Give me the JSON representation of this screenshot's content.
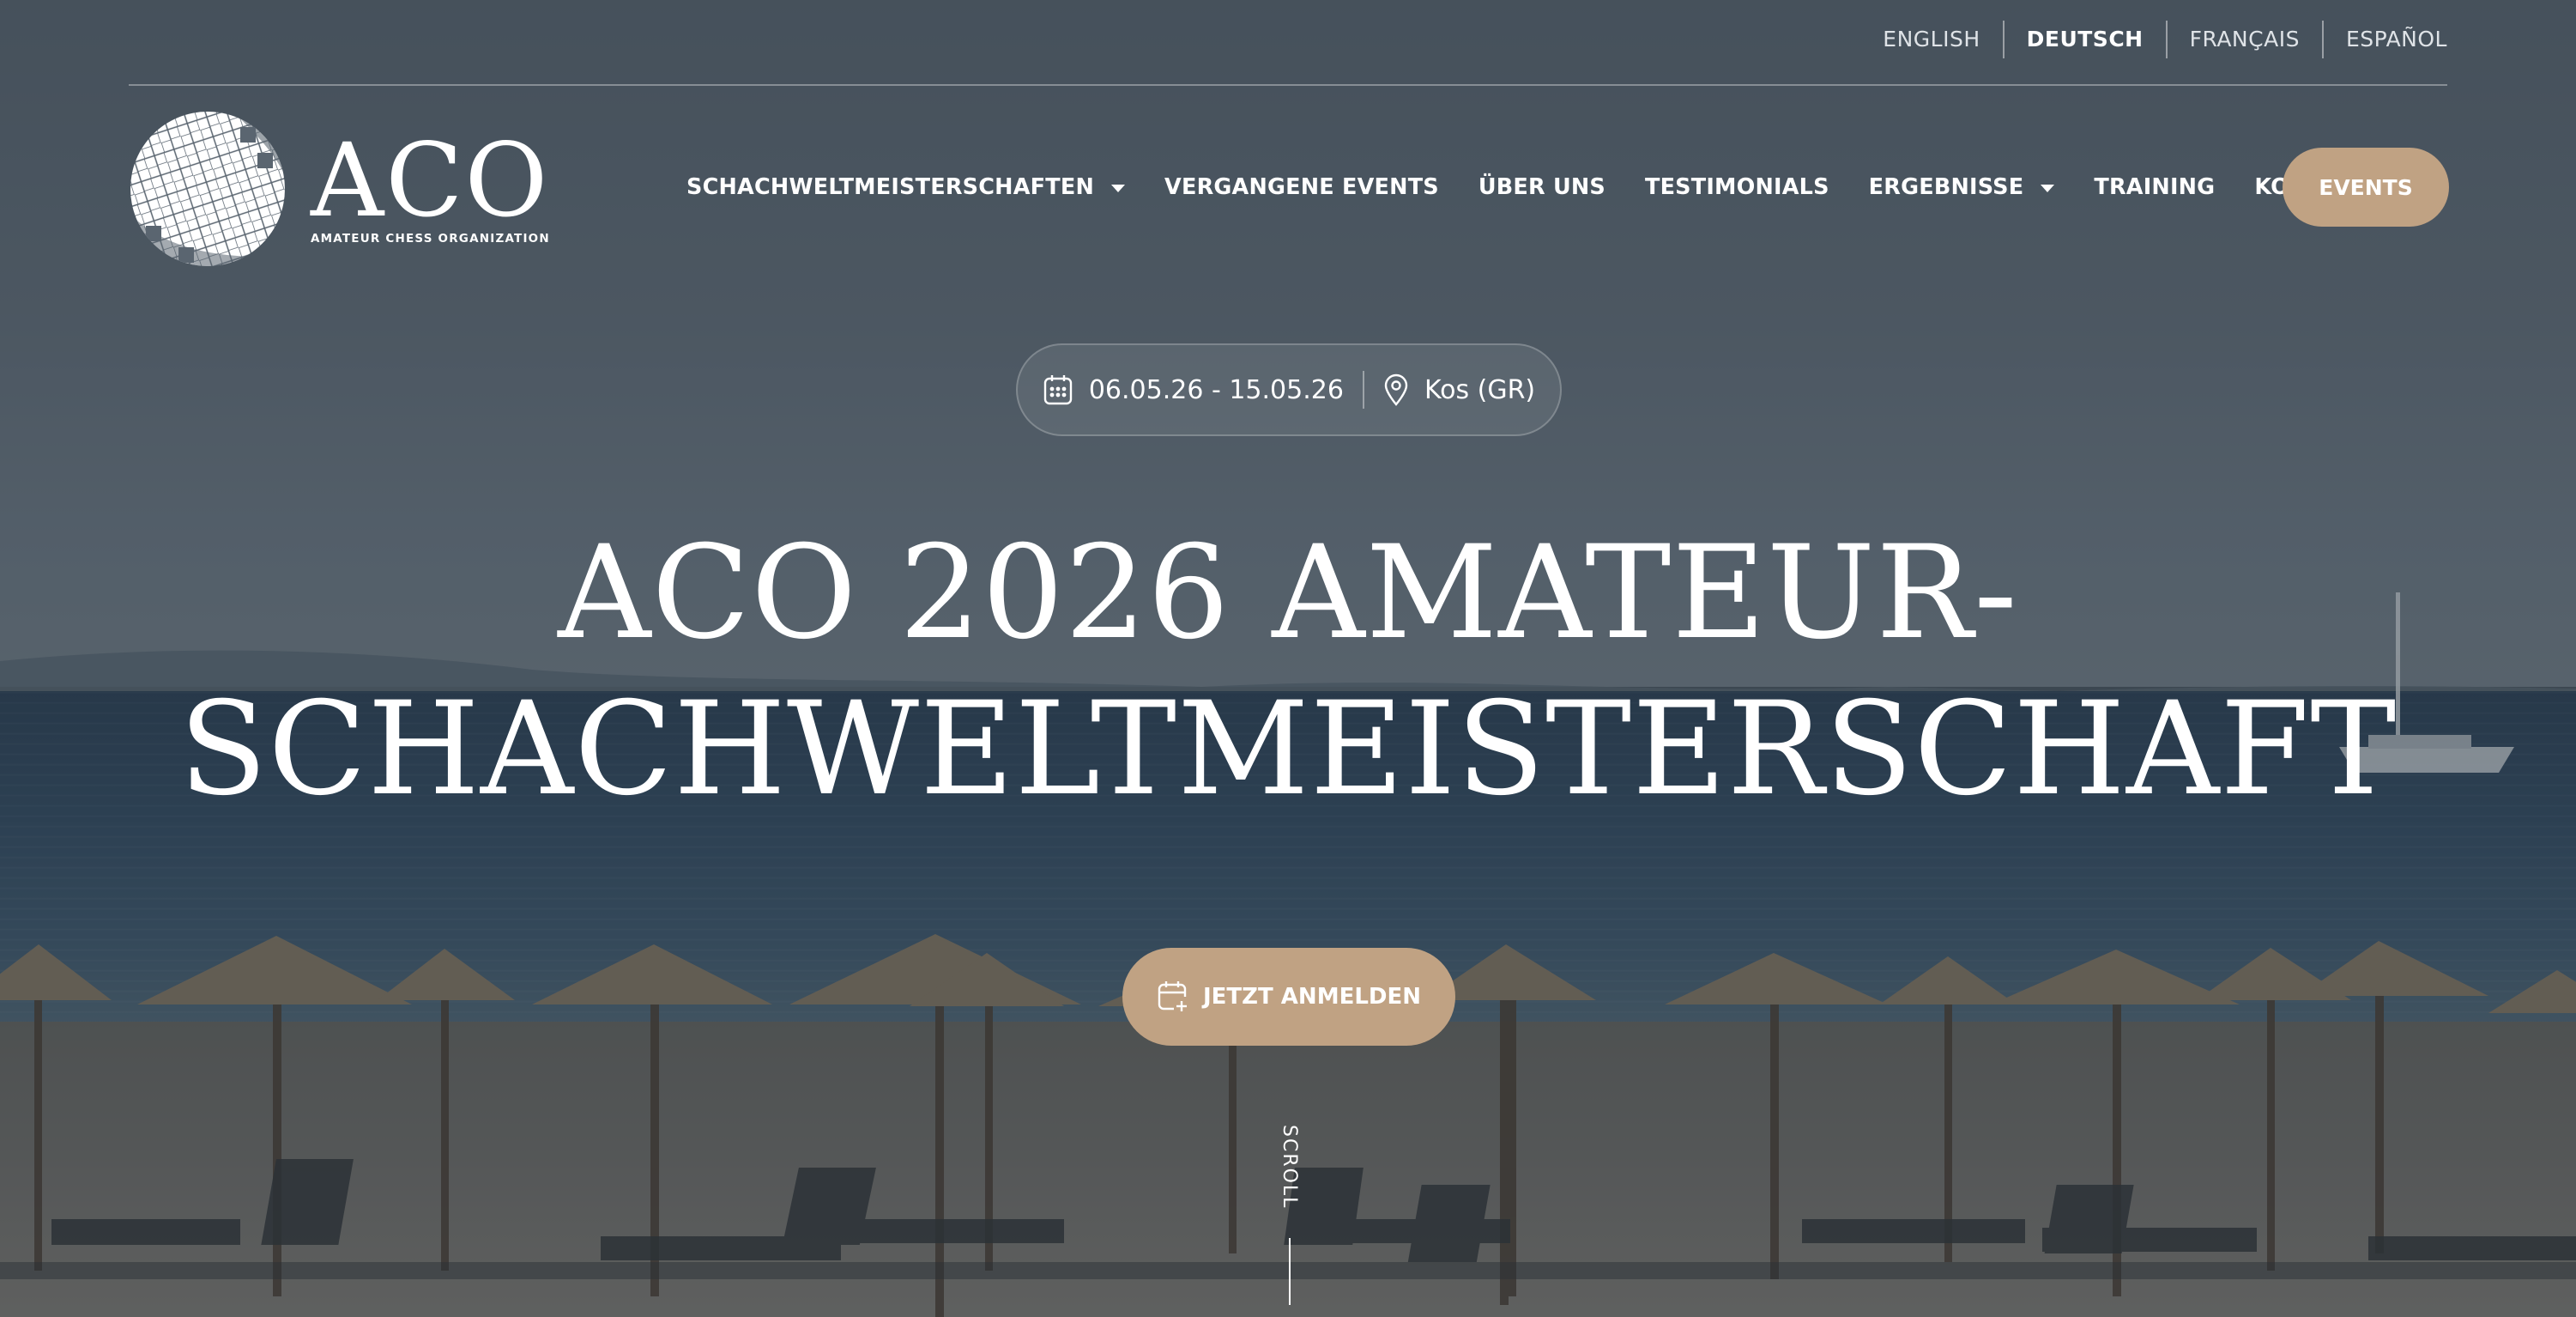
{
  "languages": [
    {
      "label": "ENGLISH",
      "active": false
    },
    {
      "label": "DEUTSCH",
      "active": true
    },
    {
      "label": "FRANÇAIS",
      "active": false
    },
    {
      "label": "ESPAÑOL",
      "active": false
    }
  ],
  "logo": {
    "name": "ACO",
    "tagline": "AMATEUR CHESS ORGANIZATION"
  },
  "nav": {
    "items": [
      {
        "label": "SCHACHWELTMEISTERSCHAFTEN",
        "dropdown": true
      },
      {
        "label": "VERGANGENE EVENTS",
        "dropdown": false
      },
      {
        "label": "ÜBER UNS",
        "dropdown": false
      },
      {
        "label": "TESTIMONIALS",
        "dropdown": false
      },
      {
        "label": "ERGEBNISSE",
        "dropdown": true
      },
      {
        "label": "TRAINING",
        "dropdown": false
      },
      {
        "label": "KONTAKT",
        "dropdown": false
      }
    ],
    "events_button": "EVENTS"
  },
  "event": {
    "dates": "06.05.26 - 15.05.26",
    "location": "Kos (GR)",
    "title_line1": "ACO 2026 AMATEUR-",
    "title_line2": "SCHACHWELTMEISTERSCHAFT",
    "cta": "JETZT ANMELDEN"
  },
  "scroll_label": "SCROLL",
  "colors": {
    "accent": "#c0a283",
    "text": "#ffffff"
  },
  "icons": {
    "date": "calendar-icon",
    "location": "map-pin-icon",
    "cta": "calendar-plus-icon"
  }
}
